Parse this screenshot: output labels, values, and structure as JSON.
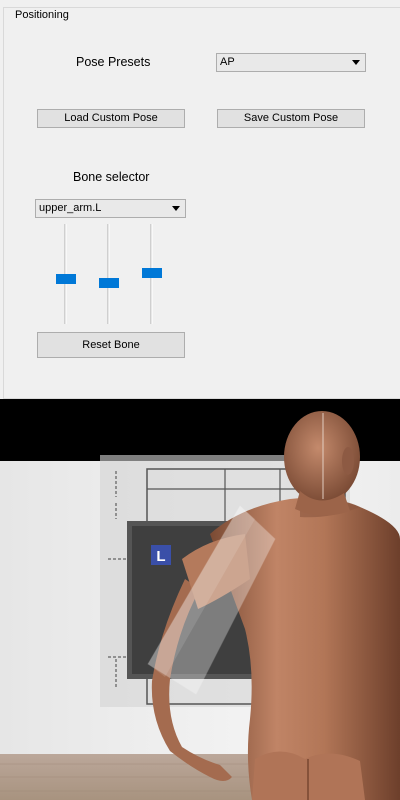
{
  "panel": {
    "group_title": "Positioning",
    "pose_presets_label": "Pose Presets",
    "pose_preset_value": "AP",
    "load_custom_pose": "Load Custom Pose",
    "save_custom_pose": "Save Custom Pose",
    "bone_selector_label": "Bone selector",
    "bone_value": "upper_arm.L",
    "reset_bone": "Reset Bone",
    "sliders": [
      0.55,
      0.6,
      0.49
    ]
  },
  "viewport": {
    "detector_marker": "L"
  },
  "colors": {
    "accent": "#0078d7",
    "marker_bg": "#3a4fa8"
  }
}
